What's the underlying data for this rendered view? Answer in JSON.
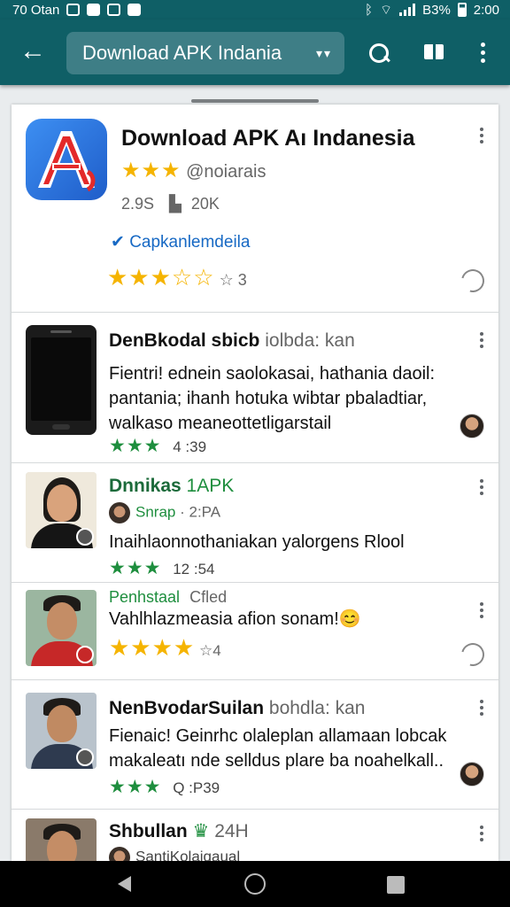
{
  "status_bar": {
    "left_text": "70 Otan",
    "right_text": "B3% ",
    "time": "2:00"
  },
  "app_bar": {
    "search_text": "Download APK Indania",
    "dropdown_glyph": "▾▾"
  },
  "main_app": {
    "title": "Download APK Aı Indanesia",
    "rating_stars": "★★★",
    "developer": "@noiarais",
    "size": "2.9S",
    "downloads": "20K",
    "link_text": "Capkanlemdeila",
    "user_stars": "★★★☆☆",
    "user_rating_count": "3",
    "accent_color": "#f5b400"
  },
  "reviews": [
    {
      "title": "DenBkodal sbicb",
      "title_suffix": "iolbda: kan",
      "body": [
        "Fientri! ednein saolokasai, hathania daoil:",
        "pantania; ihanh hotuka wibtar pbaladtiar,",
        "walkaso meaneottetligarstail"
      ],
      "stars": "★★★",
      "meta": "4 :39"
    },
    {
      "title": "Dnnikas",
      "title_badge": "1APK",
      "author": "Snrap",
      "author_meta": "· 2:PA",
      "body": [
        "Inaihlaonnothaniakan yalorgens Rlool"
      ],
      "stars": "★★★",
      "meta": "12 :54"
    },
    {
      "title": "Penhstaal",
      "title_badge": "Cfled",
      "body": [
        "Vahlhlazmeasia afion sonam!😊"
      ],
      "stars": "★★★★",
      "meta": "☆4"
    },
    {
      "title": "NenBvodarSuilan",
      "title_suffix": "bohdla: kan",
      "body": [
        "Fienaic! Geinrhc olaleplan allamaan lobcak",
        "makaleatı nde selldus plare ba noahelkall.."
      ],
      "stars": "★★★",
      "meta": "Q :P39"
    },
    {
      "title": "Shbullan",
      "title_badge": "24H",
      "author": "SantiKolaiqaual"
    }
  ],
  "colors": {
    "app_bar": "#0f5f66",
    "green": "#1e8e3e",
    "blue_link": "#1769c4"
  },
  "icons": [
    "back-arrow-icon",
    "search-icon",
    "book-icon",
    "overflow-menu-icon",
    "nav-back-icon",
    "nav-home-icon",
    "nav-recents-icon"
  ]
}
